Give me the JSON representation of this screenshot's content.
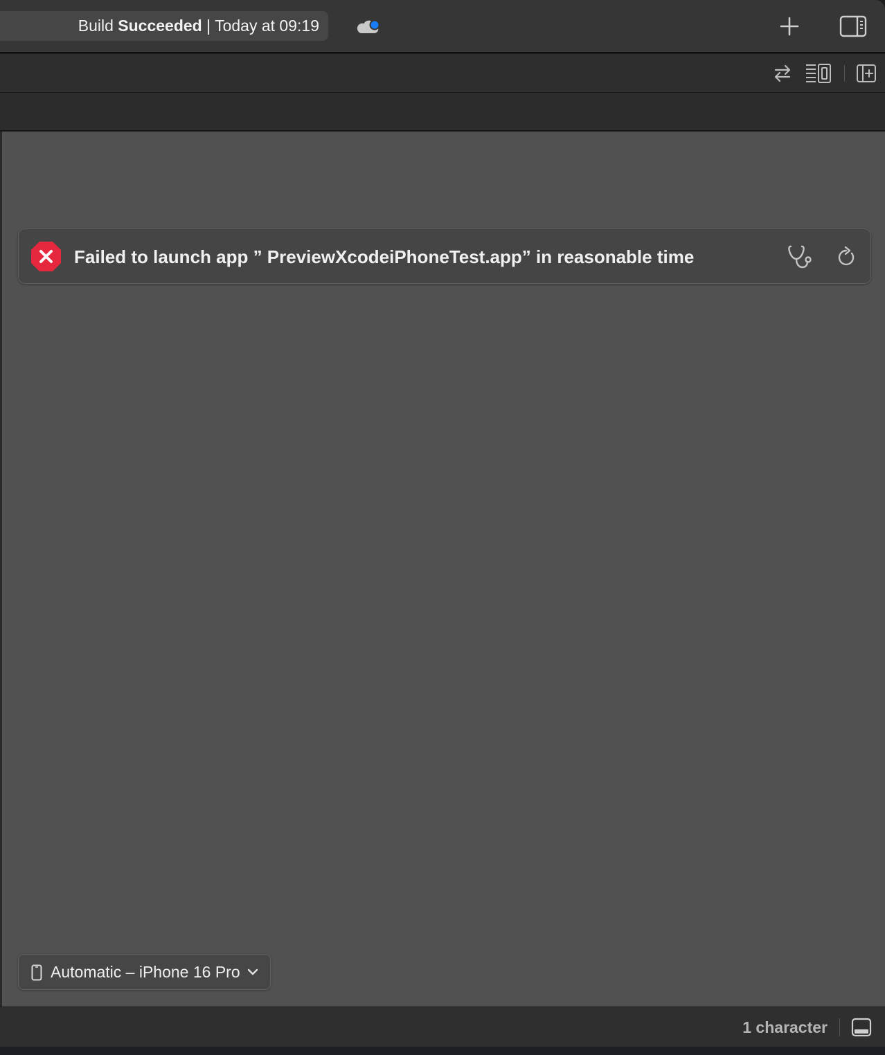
{
  "titlebar": {
    "status_prefix": "Build",
    "status_bold": "Succeeded",
    "status_separator": "|",
    "status_time": "Today at 09:19",
    "icons": [
      "cloud-icon",
      "plus-icon",
      "inspector-toggle-icon"
    ]
  },
  "editor_toolbar": {
    "icons": [
      "swap-icon",
      "canvas-layout-icon",
      "add-editor-pane-icon"
    ]
  },
  "preview": {
    "error_message": "Failed to launch app ” PreviewXcodeiPhoneTest.app” in reasonable time",
    "error_icon": "error-x-icon",
    "actions": [
      "diagnostics-icon",
      "refresh-icon"
    ],
    "device_picker_label": "Automatic – iPhone 16 Pro"
  },
  "statusbar": {
    "character_count": "1 character",
    "icons": [
      "debug-area-toggle-icon"
    ]
  },
  "colors": {
    "error_red": "#e5283d",
    "accent_blue": "#1a7cf5",
    "canvas_bg": "#515151",
    "chrome_bg": "#363636"
  }
}
